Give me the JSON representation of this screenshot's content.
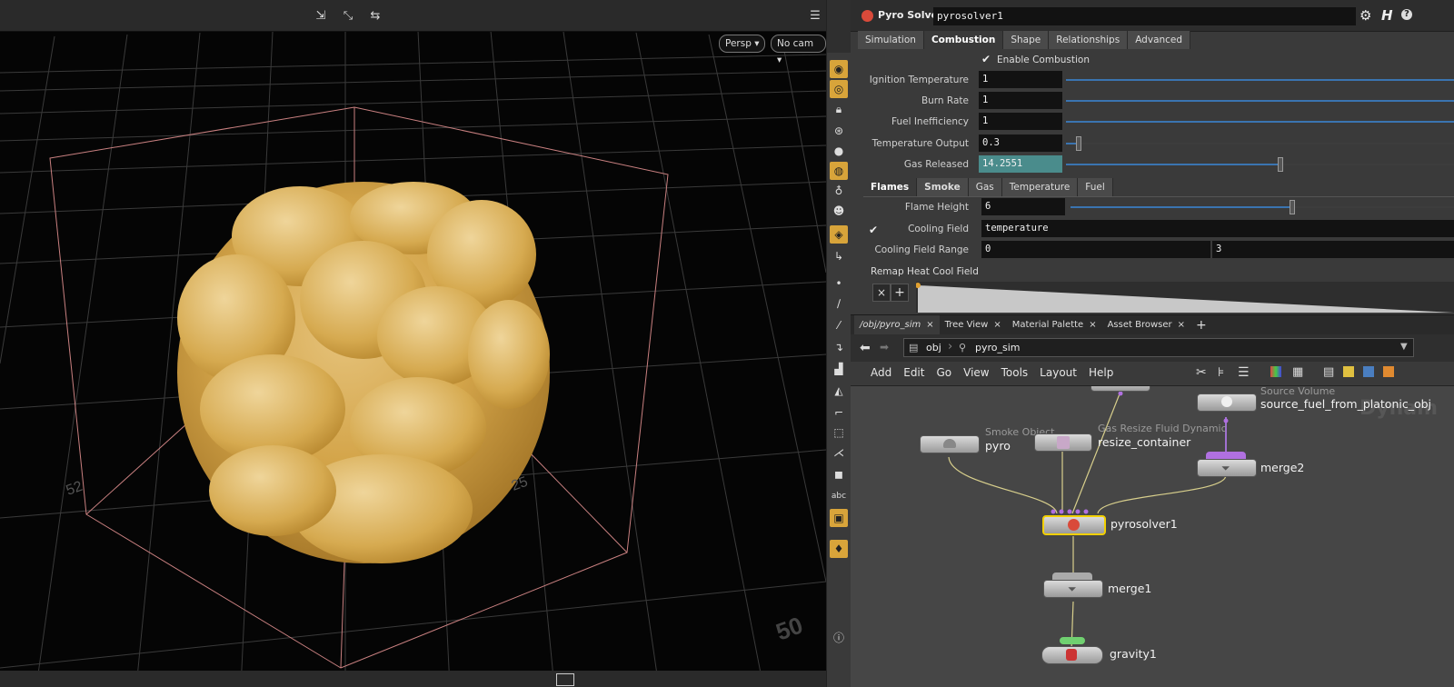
{
  "viewport": {
    "persp_label": "Persp ▾",
    "cam_label": "No cam ▾",
    "grid_numbers": [
      "52",
      "25",
      "50"
    ],
    "icons": [
      "select-icon",
      "transform-icon",
      "handle-icon",
      "display-options-icon",
      "help-icon"
    ]
  },
  "viewport_tools": {
    "items": [
      "eye-icon",
      "camera-icon",
      "lock-icon",
      "snap-icon",
      "sphere-icon",
      "light-icon",
      "light-icon",
      "skull-icon",
      "render-icon",
      "move-icon",
      "point-icon",
      "pen-icon",
      "brush-icon",
      "number-icon",
      "paint-icon",
      "bucket-icon",
      "corner-icon",
      "select-icon",
      "branch-icon",
      "stop-icon",
      "abc-label",
      "screen-icon",
      "pin-icon",
      "info-icon"
    ],
    "abc": "abc"
  },
  "param": {
    "node_type": "Pyro Solver",
    "node_name": "pyrosolver1",
    "main_tabs": [
      "Simulation",
      "Combustion",
      "Shape",
      "Relationships",
      "Advanced"
    ],
    "enable_combustion_label": "Enable Combustion",
    "rows": [
      {
        "label": "Ignition Temperature",
        "value": "1"
      },
      {
        "label": "Burn Rate",
        "value": "1"
      },
      {
        "label": "Fuel Inefficiency",
        "value": "1"
      },
      {
        "label": "Temperature Output",
        "value": "0.3"
      },
      {
        "label": "Gas Released",
        "value": "14.2551"
      }
    ],
    "sub_tabs": [
      "Flames",
      "Smoke",
      "Gas",
      "Temperature",
      "Fuel"
    ],
    "flame_height_label": "Flame Height",
    "flame_height_value": "6",
    "cooling_field_label": "Cooling Field",
    "cooling_field_value": "temperature",
    "cooling_range_label": "Cooling Field Range",
    "cooling_range_min": "0",
    "cooling_range_max": "3",
    "remap_label": "Remap Heat Cool Field",
    "remap_x": "×",
    "remap_plus": "+",
    "accent_color": "#d8a43a",
    "gas_field_color": "#4a8c8c",
    "slider_levels": {
      "ignition": 1.0,
      "burn": 1.0,
      "fuel": 1.0,
      "temp_output": 0.03,
      "gas_released": 0.6,
      "flame_height": 0.6
    }
  },
  "network": {
    "tabs": [
      "/obj/pyro_sim",
      "Tree View",
      "Material Palette",
      "Asset Browser"
    ],
    "tab_close": "×",
    "tab_add": "+",
    "path": [
      "obj",
      "pyro_sim"
    ],
    "menu": [
      "Add",
      "Edit",
      "Go",
      "View",
      "Tools",
      "Layout",
      "Help"
    ],
    "watermark": "Dynam",
    "nodes": [
      {
        "label": "source_fuel_from_platonic_obj",
        "type": "Source Volume"
      },
      {
        "label": "pyro",
        "type": "Smoke Object"
      },
      {
        "label": "resize_container",
        "type": "Gas Resize Fluid Dynamic"
      },
      {
        "label": "merge2",
        "type": ""
      },
      {
        "label": "pyrosolver1",
        "type": ""
      },
      {
        "label": "merge1",
        "type": ""
      },
      {
        "label": "gravity1",
        "type": ""
      }
    ]
  }
}
